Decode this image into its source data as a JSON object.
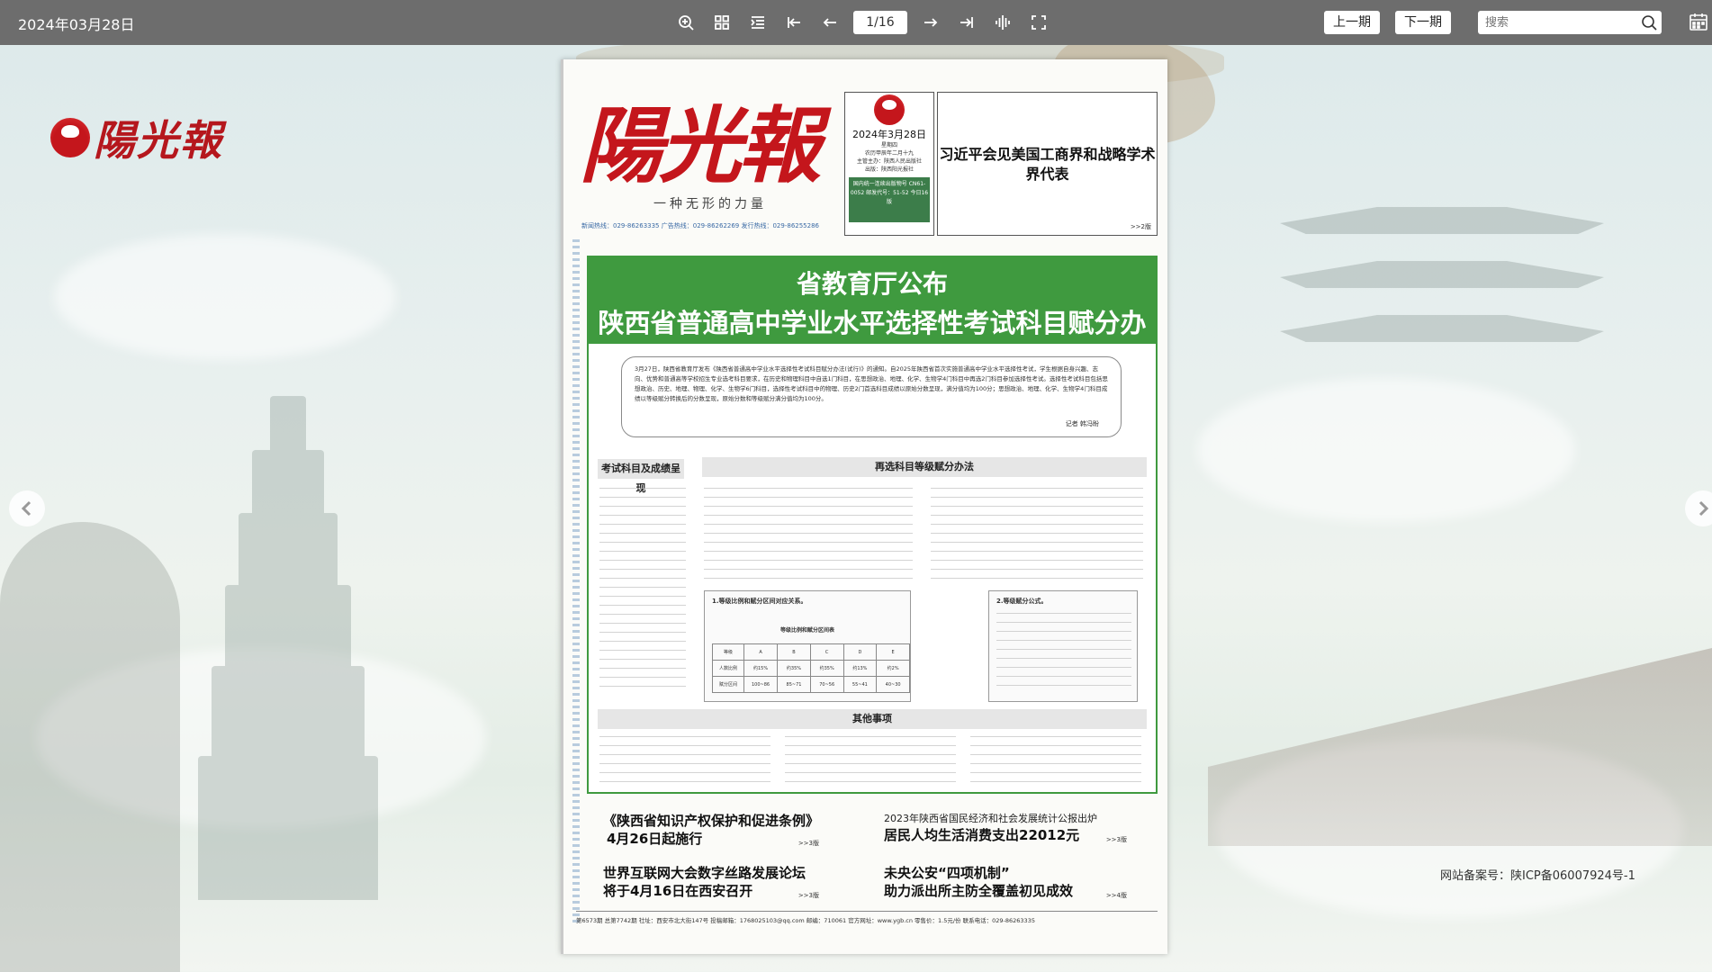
{
  "toolbar": {
    "date": "2024年03月28日",
    "page_indicator": "1/16",
    "prev_issue": "上一期",
    "next_issue": "下一期",
    "search_placeholder": "搜索"
  },
  "site": {
    "logo_text": "陽光報",
    "icp": "网站备案号：陕ICP备06007924号-1"
  },
  "paper": {
    "masthead": "陽光報",
    "slogan": "一种无形的力量",
    "hotlines": "新闻热线：029-86263335  广告热线：029-86262269  发行热线：029-86255286",
    "date_box": {
      "date": "2024年3月28日",
      "weekday": "星期四",
      "lunar": "农历甲辰年二月十九",
      "sponsor": "主管主办：陕西人民出版社",
      "publisher": "出版：陕西阳光报社",
      "green": "国内统一连续出版物号 CN61-0052 邮发代号：51-52 今日16版"
    },
    "lead_story": {
      "title": "习近平会见美国工商界和战略学术界代表",
      "ref": ">>2版"
    },
    "headline": {
      "sub": "省教育厅公布",
      "main": "陕西省普通高中学业水平选择性考试科目赋分办法(试行)"
    },
    "intro": {
      "text": "3月27日，陕西省教育厅发布《陕西省普通高中学业水平选择性考试科目赋分办法(试行)》的通知。自2025年陕西省首次实施普通高中学业水平选择性考试，学生根据自身兴趣、志向、优势和普通高等学校招生专业选考科目要求，在历史和物理科目中自选1门科目，在思想政治、地理、化学、生物学4门科目中再选2门科目参加选择性考试。选择性考试科目包括思想政治、历史、地理、物理、化学、生物学6门科目，选择性考试科目中的物理、历史2门首选科目成绩以原始分数呈现，满分值均为100分；思想政治、地理、化学、生物学4门科目成绩以等级赋分转换后的分数呈现，原始分数和等级赋分满分值均为100分。",
      "author": "记者 韩冯盼"
    },
    "sections": {
      "left_header": "考试科目及成绩呈现",
      "right_header": "再选科目等级赋分办法",
      "other_header": "其他事项",
      "box1_title": "1.等级比例和赋分区间对应关系。",
      "box2_title": "2.等级赋分公式。",
      "table_title": "等级比例和赋分区间表",
      "table": {
        "header": [
          "等级",
          "A",
          "B",
          "C",
          "D",
          "E"
        ],
        "rows": [
          [
            "人数比例",
            "约15%",
            "约35%",
            "约35%",
            "约13%",
            "约2%"
          ],
          [
            "赋分区间",
            "100~86",
            "85~71",
            "70~56",
            "55~41",
            "40~30"
          ]
        ]
      }
    },
    "news": [
      {
        "title_line1": "《陕西省知识产权保护和促进条例》",
        "title_line2": "4月26日起施行",
        "ref": ">>3版"
      },
      {
        "title_line1": "2023年陕西省国民经济和社会发展统计公报出炉",
        "title_line2": "居民人均生活消费支出22012元",
        "ref": ">>3版"
      },
      {
        "title_line1": "世界互联网大会数字丝路发展论坛",
        "title_line2": "将于4月16日在西安召开",
        "ref": ">>3版"
      },
      {
        "title_line1": "未央公安“四项机制”",
        "title_line2": "助力派出所主防全覆盖初见成效",
        "ref": ">>4版"
      }
    ],
    "footer": "第6573期  总第7742期  社址：西安市北大街147号  投稿邮箱：1768025103@qq.com  邮编：710061  官方网址：www.ygb.cn  零售价：1.5元/份  联系电话：029-86263335"
  }
}
